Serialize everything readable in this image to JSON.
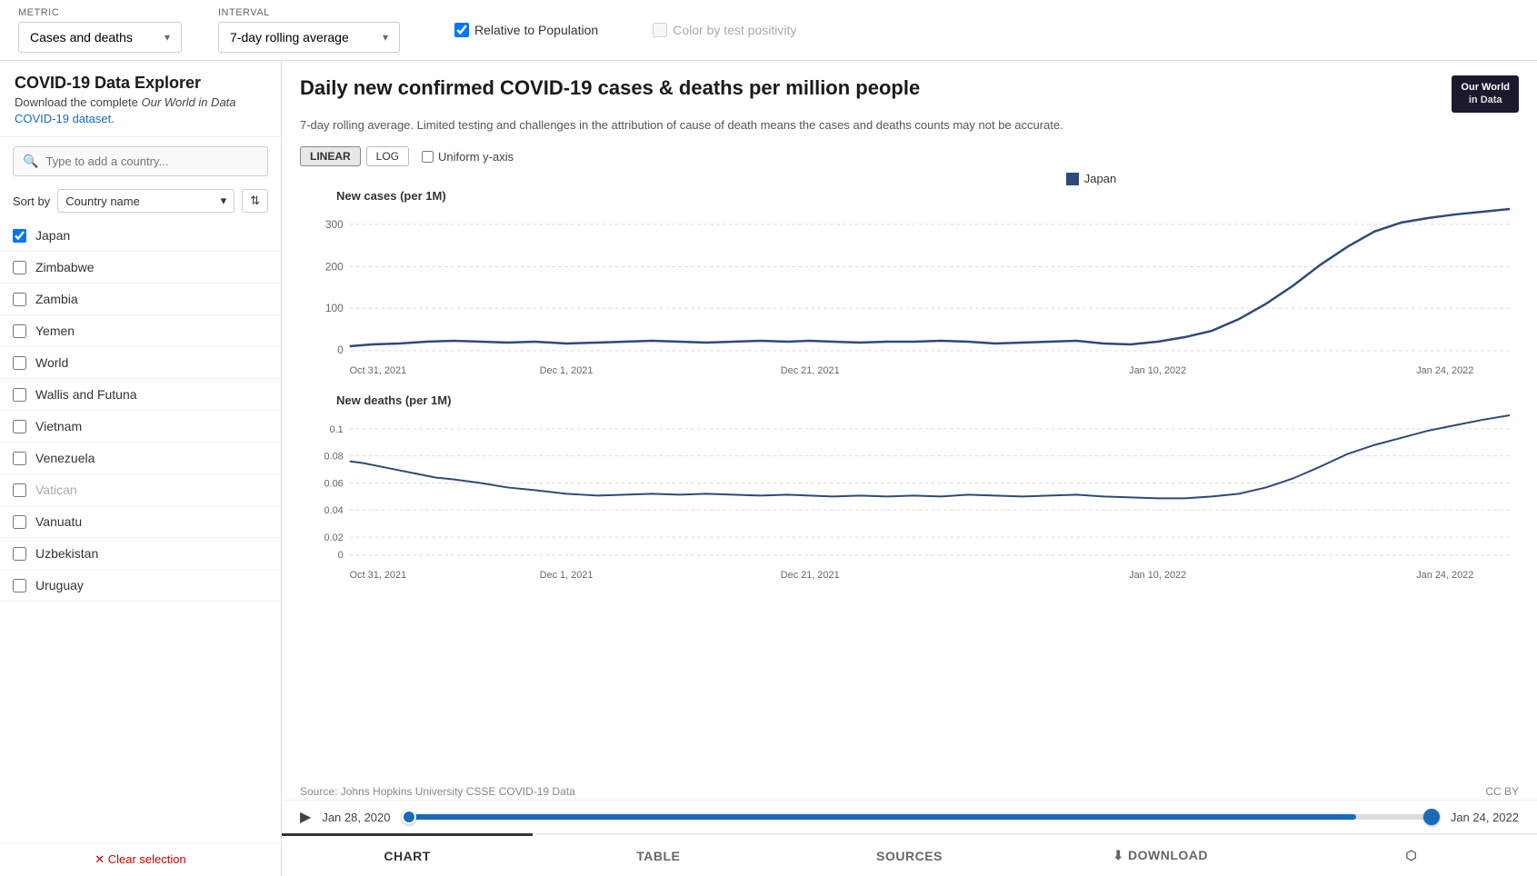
{
  "app": {
    "title": "COVID-19 Data Explorer",
    "subtitle_text": "Download the complete ",
    "subtitle_italic": "Our World in Data",
    "subtitle_link": "COVID-19 dataset.",
    "subtitle_link_text": "COVID-19 dataset."
  },
  "topbar": {
    "metric_label": "METRIC",
    "metric_value": "Cases and deaths",
    "interval_label": "INTERVAL",
    "interval_value": "7-day rolling average",
    "relative_label": "Relative to Population",
    "relative_checked": true,
    "color_label": "Color by test positivity",
    "color_checked": false
  },
  "sidebar": {
    "search_placeholder": "Type to add a country...",
    "sort_label": "Sort by",
    "sort_value": "Country name",
    "countries": [
      {
        "name": "Japan",
        "checked": true,
        "grayed": false
      },
      {
        "name": "Zimbabwe",
        "checked": false,
        "grayed": false
      },
      {
        "name": "Zambia",
        "checked": false,
        "grayed": false
      },
      {
        "name": "Yemen",
        "checked": false,
        "grayed": false
      },
      {
        "name": "World",
        "checked": false,
        "grayed": false
      },
      {
        "name": "Wallis and Futuna",
        "checked": false,
        "grayed": false
      },
      {
        "name": "Vietnam",
        "checked": false,
        "grayed": false
      },
      {
        "name": "Venezuela",
        "checked": false,
        "grayed": false
      },
      {
        "name": "Vatican",
        "checked": false,
        "grayed": true
      },
      {
        "name": "Vanuatu",
        "checked": false,
        "grayed": false
      },
      {
        "name": "Uzbekistan",
        "checked": false,
        "grayed": false
      },
      {
        "name": "Uruguay",
        "checked": false,
        "grayed": false
      }
    ],
    "clear_label": "✕ Clear selection"
  },
  "chart": {
    "title": "Daily new confirmed COVID-19 cases & deaths per million people",
    "subtitle": "7-day rolling average. Limited testing and challenges in the attribution of cause of death means the cases and deaths counts may not be accurate.",
    "owid_logo_line1": "Our World",
    "owid_logo_line2": "in Data",
    "legend_country": "Japan",
    "linear_label": "LINEAR",
    "log_label": "LOG",
    "uniform_label": "Uniform y-axis",
    "cases_label": "New cases (per 1M)",
    "deaths_label": "New deaths (per 1M)",
    "x_ticks": [
      "Oct 31, 2021",
      "Dec 1, 2021",
      "Dec 21, 2021",
      "Jan 10, 2022",
      "Jan 24, 2022"
    ],
    "cases_y_ticks": [
      "300",
      "200",
      "100",
      "0"
    ],
    "deaths_y_ticks": [
      "0.1",
      "0.08",
      "0.06",
      "0.04",
      "0.02",
      "0"
    ],
    "source": "Source: Johns Hopkins University CSSE COVID-19 Data",
    "cc": "CC BY"
  },
  "timeline": {
    "start_date": "Jan 28, 2020",
    "end_date": "Jan 24, 2022"
  },
  "tabs": [
    {
      "label": "CHART",
      "active": true
    },
    {
      "label": "TABLE",
      "active": false
    },
    {
      "label": "SOURCES",
      "active": false
    },
    {
      "label": "⬇ DOWNLOAD",
      "active": false
    },
    {
      "label": "⬡",
      "active": false
    }
  ]
}
